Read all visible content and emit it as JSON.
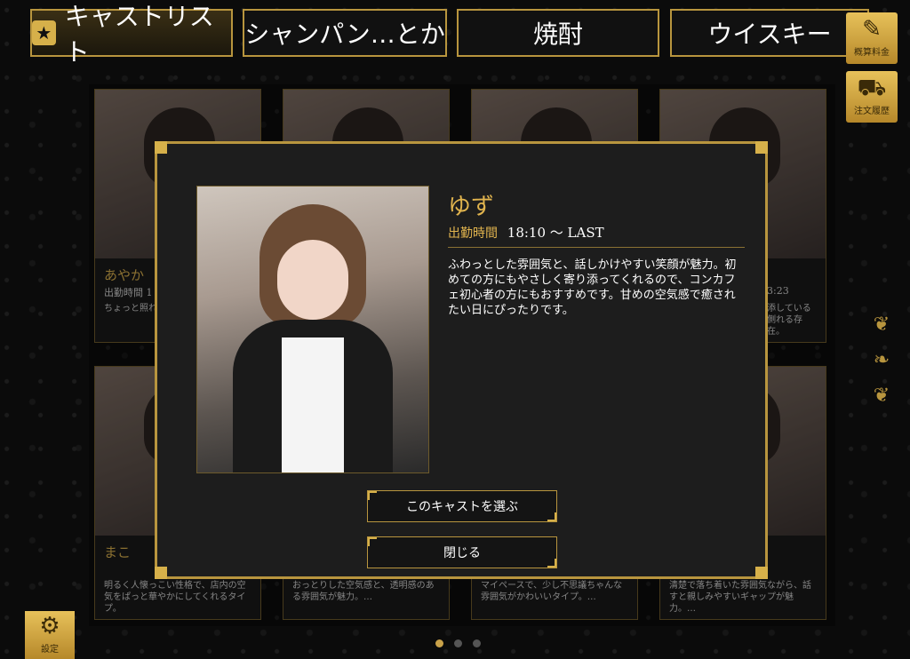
{
  "tabs": [
    {
      "label": "キャストリスト",
      "active": true
    },
    {
      "label": "シャンパン…とか",
      "active": false
    },
    {
      "label": "焼酎",
      "active": false
    },
    {
      "label": "ウイスキー",
      "active": false
    }
  ],
  "side_buttons": {
    "bill": {
      "icon": "receipt-icon",
      "label": "概算料金"
    },
    "order_history": {
      "icon": "cart-icon",
      "label": "注文履歴"
    }
  },
  "settings": {
    "icon": "gear-icon",
    "label": "設定"
  },
  "cards": [
    {
      "name": "あやか",
      "time": "出勤時間 1",
      "desc": "ちょっと照れ…な距離感が"
    },
    {
      "name": "",
      "time": "",
      "desc": ""
    },
    {
      "name": "",
      "time": "",
      "desc": ""
    },
    {
      "name": "",
      "time": "3:23",
      "desc": "添している側れる存在。"
    },
    {
      "name": "まこ",
      "time": "",
      "desc": "明るく人懐っこい性格で、店内の空気をぱっと華やかにしてくれるタイプ。"
    },
    {
      "name": "",
      "time": "",
      "desc": "おっとりした空気感と、透明感のある雰囲気が魅力。…"
    },
    {
      "name": "",
      "time": "",
      "desc": "マイペースで、少し不思議ちゃんな雰囲気がかわいいタイプ。…"
    },
    {
      "name": "",
      "time": "",
      "desc": "清楚で落ち着いた雰囲気ながら、話すと親しみやすいギャップが魅力。…"
    }
  ],
  "modal": {
    "name": "ゆず",
    "shift_label": "出勤時間",
    "shift_value": "18:10 〜 LAST",
    "description": "ふわっとした雰囲気と、話しかけやすい笑顔が魅力。初めての方にもやさしく寄り添ってくれるので、コンカフェ初心者の方にもおすすめです。甘めの空気感で癒されたい日にぴったりです。",
    "select_button": "このキャストを選ぶ",
    "close_button": "閉じる"
  },
  "pagination": {
    "pages": 3,
    "current": 1
  },
  "colors": {
    "accent": "#b8953e",
    "gold_text": "#e1b44e"
  }
}
